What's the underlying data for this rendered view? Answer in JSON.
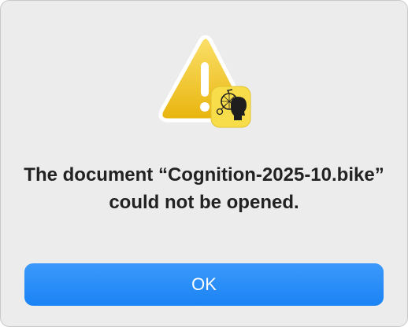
{
  "alert": {
    "message": "The document “Cognition-2025-10.bike” could not be opened.",
    "ok_label": "OK",
    "warning_icon": "warning-triangle-icon",
    "app_icon": "penny-farthing-head-icon",
    "colors": {
      "warning_yellow": "#f5c518",
      "app_icon_yellow": "#f7dd4a",
      "button_blue": "#2a8cf7",
      "background": "#ececec"
    }
  }
}
